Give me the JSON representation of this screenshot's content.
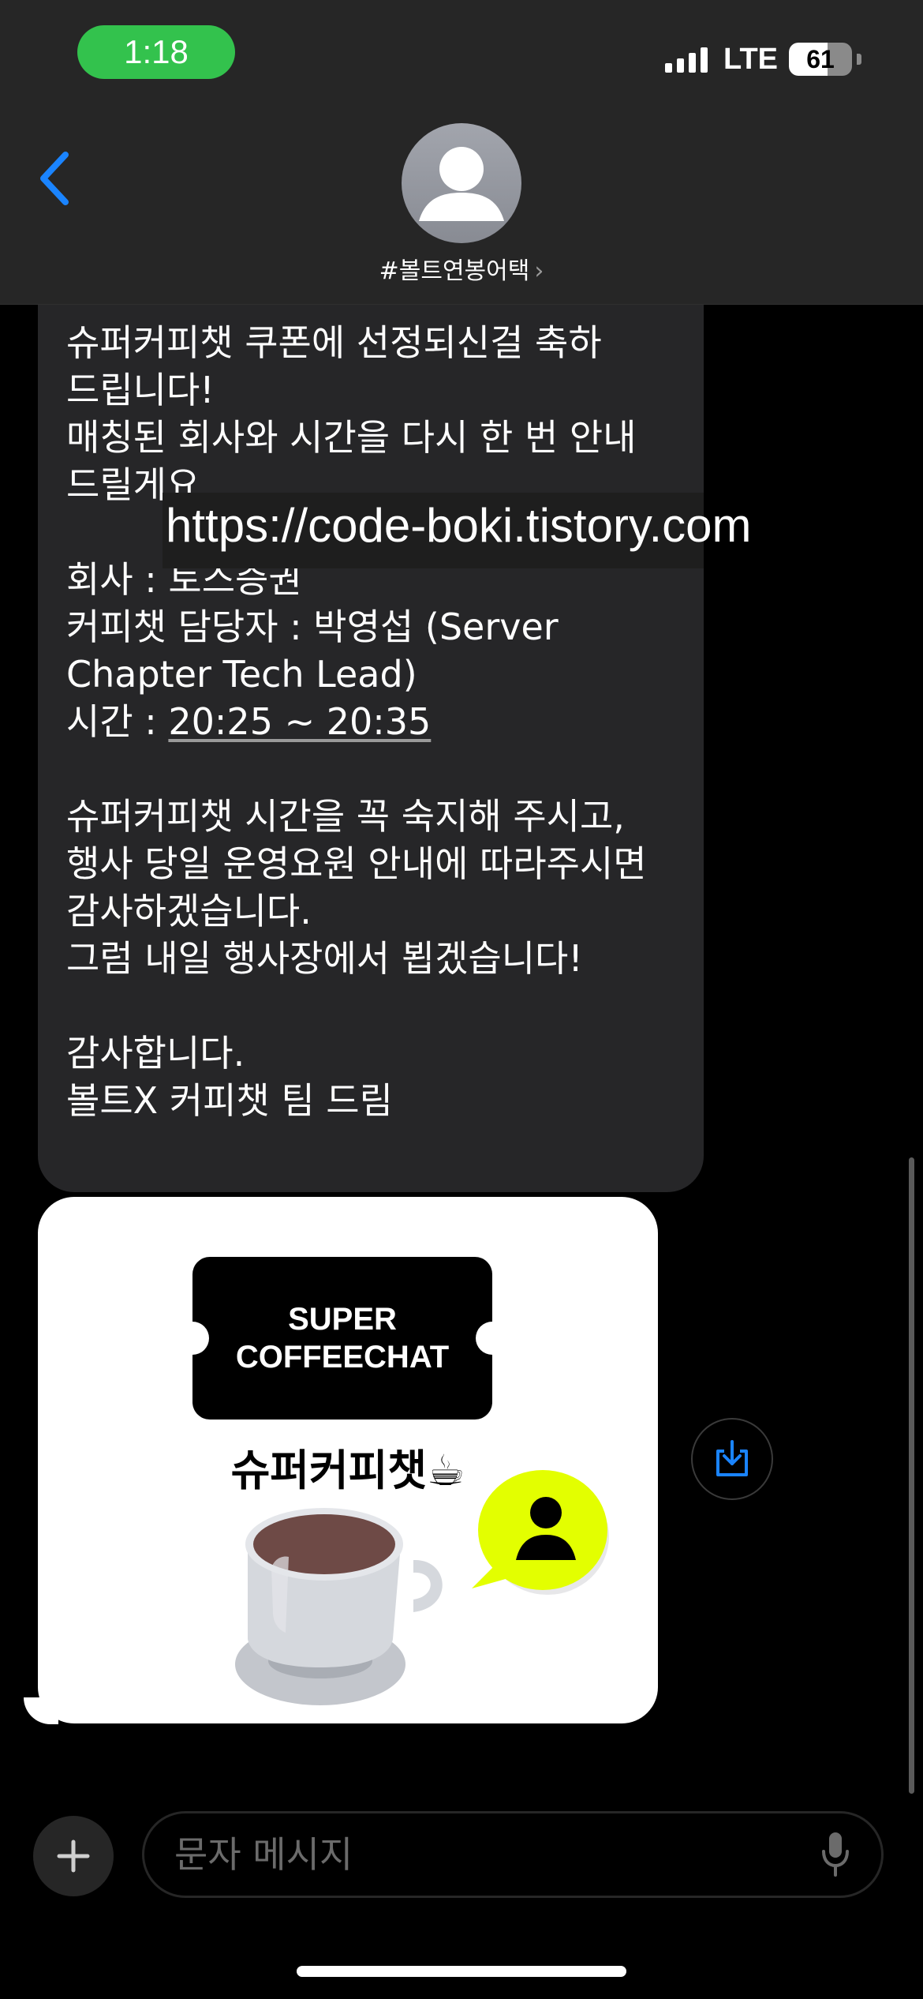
{
  "status_bar": {
    "time": "1:18",
    "network": "LTE",
    "battery_text": "61",
    "battery_level": 0.61
  },
  "header": {
    "contact_name": "#볼트연봉어택",
    "back_icon": "chevron-left-icon",
    "avatar_icon": "person-avatar-icon"
  },
  "message": {
    "lines": [
      "슈퍼커피챗 쿠폰에 선정되신걸 축하",
      "드립니다!",
      "매칭된 회사와 시간을 다시 한 번 안내",
      "드릴게요.",
      "회사 : 토스증권",
      "커피챗 담당자 : 박영섭 (Server",
      "Chapter Tech Lead)",
      "슈퍼커피챗 시간을 꼭 숙지해 주시고,",
      "행사 당일 운영요원 안내에 따라주시면",
      "감사하겠습니다.",
      "그럼 내일 행사장에서 뵙겠습니다!",
      "감사합니다.",
      "볼트X 커피챗 팀 드림"
    ],
    "time_label": "시간 : ",
    "time_value": "20:25 ~ 20:35"
  },
  "watermark": "https://code-boki.tistory.com",
  "image_card": {
    "ticket_line1": "SUPER",
    "ticket_line2": "COFFEECHAT",
    "title": "슈퍼커피챗☕"
  },
  "save_button_icon": "save-download-icon",
  "input": {
    "placeholder": "문자 메시지",
    "plus_icon": "plus-icon",
    "mic_icon": "microphone-icon"
  },
  "colors": {
    "accent_blue": "#1a84ff",
    "time_green": "#33c24d",
    "bubble_gray": "#262628",
    "highlight_yellow": "#e3ff00"
  }
}
